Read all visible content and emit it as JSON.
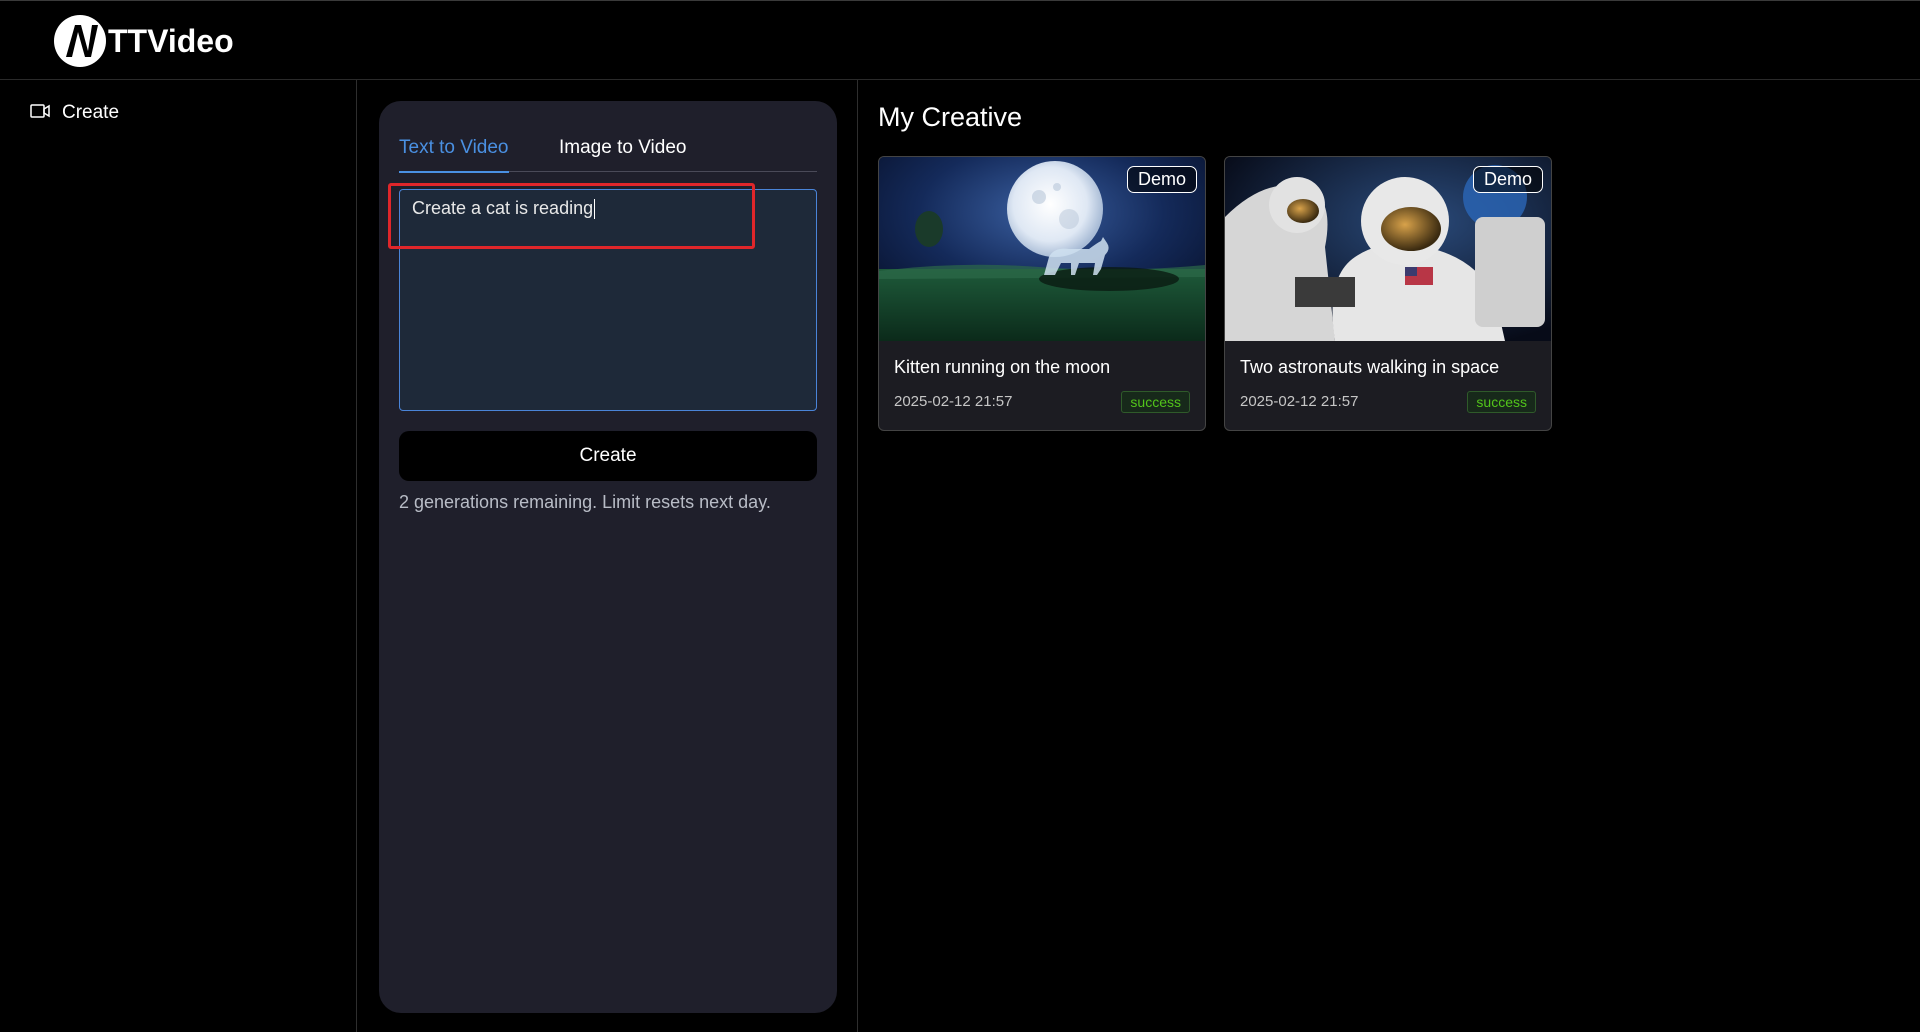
{
  "app": {
    "name": "TTVideo"
  },
  "sidebar": {
    "items": [
      {
        "label": "Create",
        "icon": "video-camera-icon"
      }
    ]
  },
  "panel": {
    "tabs": [
      {
        "label": "Text to Video",
        "active": true
      },
      {
        "label": "Image to Video",
        "active": false
      }
    ],
    "prompt_value": "Create a cat is reading",
    "create_label": "Create",
    "remaining_text": "2 generations remaining. Limit resets next day."
  },
  "creative": {
    "title": "My Creative",
    "cards": [
      {
        "badge": "Demo",
        "title": "Kitten running on the moon",
        "date": "2025-02-12 21:57",
        "status": "success"
      },
      {
        "badge": "Demo",
        "title": "Two astronauts walking in space",
        "date": "2025-02-12 21:57",
        "status": "success"
      }
    ]
  },
  "colors": {
    "accent": "#4a90e2",
    "success": "#52c41a",
    "highlight": "#e0262a",
    "panel_bg": "#1f1f2b"
  }
}
